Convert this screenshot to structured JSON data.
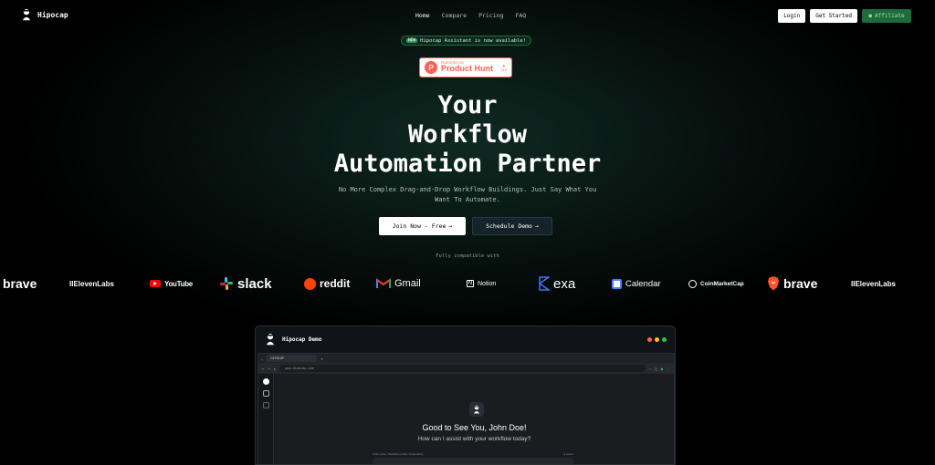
{
  "brand": {
    "name": "Hipocap"
  },
  "nav": {
    "links": [
      "Home",
      "Compare",
      "Pricing",
      "FAQ"
    ],
    "login": "Login",
    "get_started": "Get Started",
    "affiliate": "Affiliate"
  },
  "announcement": {
    "badge": "NEW",
    "text": "Hipocap Assistant is now available!"
  },
  "product_hunt": {
    "featured": "FEATURED ON",
    "name": "Product Hunt",
    "votes": "110"
  },
  "hero": {
    "line1": "Your",
    "line2": "Workflow",
    "line3": "Automation Partner",
    "subtitle": "No More Complex Drag-and-Drop Workflow Buildings. Just Say What You Want To Automate.",
    "cta_primary": "Join Now - Free",
    "cta_secondary": "Schedule Demo",
    "compat": "Fully compatible with"
  },
  "logos": [
    "brave",
    "IIElevenLabs",
    "YouTube",
    "slack",
    "reddit",
    "Gmail",
    "Notion",
    "exa",
    "Calendar",
    "CoinMarketCap",
    "brave",
    "IIElevenLabs"
  ],
  "demo": {
    "title": "Hipocap Demo",
    "tab": "HIPOCAP",
    "url": "app.hipocap.com",
    "greeting": "Good to See You, John Doe!",
    "question": "How can I assist with your workflow today?",
    "meta_left": "Chat mode / Workflow mode / Automation...",
    "meta_right": "Active"
  },
  "colors": {
    "accent_green": "#1d6b3d",
    "producthunt": "#ff6154"
  }
}
